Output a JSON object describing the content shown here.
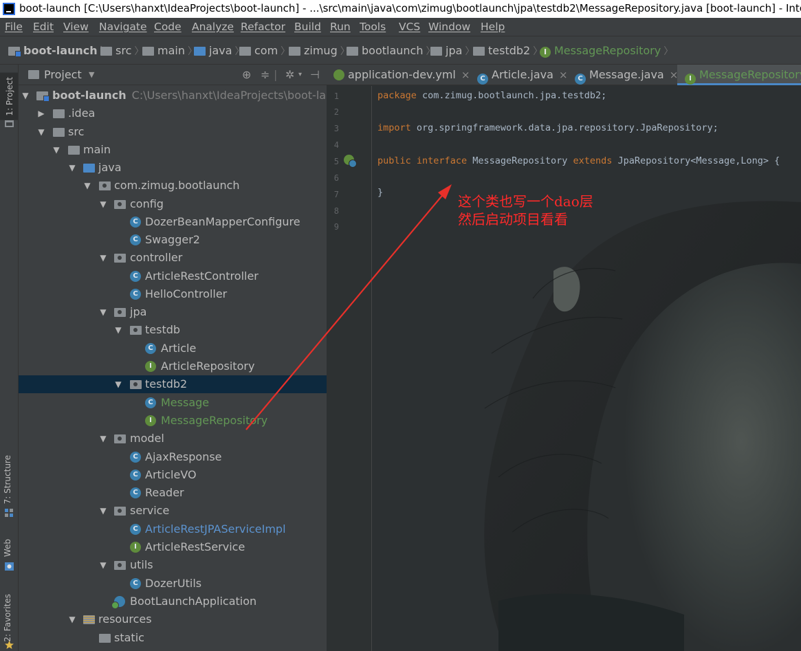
{
  "window": {
    "title": "boot-launch [C:\\Users\\hanxt\\IdeaProjects\\boot-launch] - ...\\src\\main\\java\\com\\zimug\\bootlaunch\\jpa\\testdb2\\MessageRepository.java [boot-launch] - IntelliJ"
  },
  "menu": [
    "File",
    "Edit",
    "View",
    "Navigate",
    "Code",
    "Analyze",
    "Refactor",
    "Build",
    "Run",
    "Tools",
    "VCS",
    "Window",
    "Help"
  ],
  "breadcrumb": [
    "boot-launch",
    "src",
    "main",
    "java",
    "com",
    "zimug",
    "bootlaunch",
    "jpa",
    "testdb2",
    "MessageRepository"
  ],
  "toolstrip": {
    "project": "1: Project",
    "structure": "7: Structure",
    "web": "Web",
    "favorites": "2: Favorites"
  },
  "project_panel": {
    "title": "Project",
    "tree": [
      {
        "label": "boot-launch",
        "path": "C:\\Users\\hanxt\\IdeaProjects\\boot-launch"
      },
      {
        "label": ".idea"
      },
      {
        "label": "src"
      },
      {
        "label": "main"
      },
      {
        "label": "java"
      },
      {
        "label": "com.zimug.bootlaunch"
      },
      {
        "label": "config"
      },
      {
        "label": "DozerBeanMapperConfigure"
      },
      {
        "label": "Swagger2"
      },
      {
        "label": "controller"
      },
      {
        "label": "ArticleRestController"
      },
      {
        "label": "HelloController"
      },
      {
        "label": "jpa"
      },
      {
        "label": "testdb"
      },
      {
        "label": "Article"
      },
      {
        "label": "ArticleRepository"
      },
      {
        "label": "testdb2"
      },
      {
        "label": "Message"
      },
      {
        "label": "MessageRepository"
      },
      {
        "label": "model"
      },
      {
        "label": "AjaxResponse"
      },
      {
        "label": "ArticleVO"
      },
      {
        "label": "Reader"
      },
      {
        "label": "service"
      },
      {
        "label": "ArticleRestJPAServiceImpl"
      },
      {
        "label": "ArticleRestService"
      },
      {
        "label": "utils"
      },
      {
        "label": "DozerUtils"
      },
      {
        "label": "BootLaunchApplication"
      },
      {
        "label": "resources"
      },
      {
        "label": "static"
      }
    ]
  },
  "editor": {
    "tabs": [
      "application-dev.yml",
      "Article.java",
      "Message.java",
      "MessageRepository.java"
    ],
    "active_tab": "MessageRepository.java",
    "line_numbers": [
      "1",
      "2",
      "3",
      "4",
      "5",
      "6",
      "7",
      "8",
      "9"
    ],
    "code": {
      "line1_kw": "package",
      "line1_rest": " com.zimug.bootlaunch.jpa.testdb2;",
      "line3_kw": "import",
      "line3_rest": " org.springframework.data.jpa.repository.JpaRepository;",
      "line5_kw1": "public",
      "line5_kw2": "interface",
      "line5_name": " MessageRepository ",
      "line5_kw3": "extends",
      "line5_rest": " JpaRepository<Message,Long> {",
      "line7": "}"
    },
    "annotation": {
      "line1": "这个类也写一个dao层",
      "line2": "然后启动项目看看"
    }
  },
  "icons": {
    "class": "C",
    "interface": "I"
  },
  "colors": {
    "keyword": "#cc7832",
    "annotation_red": "#ff2a2a",
    "selection": "#0d293e",
    "interface_green": "#629755"
  }
}
